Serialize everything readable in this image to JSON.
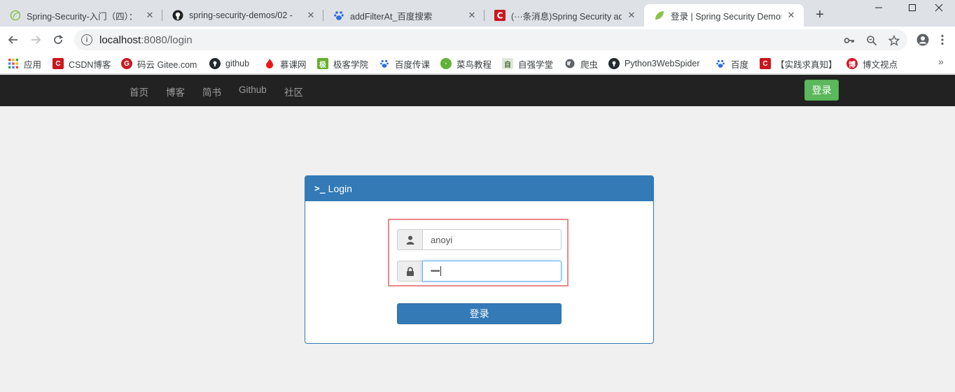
{
  "tabs": [
    {
      "title": "Spring-Security-入门（四）：",
      "active": false
    },
    {
      "title": "spring-security-demos/02 - ",
      "active": false
    },
    {
      "title": "addFilterAt_百度搜索",
      "active": false
    },
    {
      "title": "(···条消息)Spring Security add",
      "active": false
    },
    {
      "title": "登录 | Spring Security Demos",
      "active": true
    }
  ],
  "address": {
    "host": "localhost",
    "rest": ":8080/login"
  },
  "bookmarks": [
    {
      "label": "应用",
      "icon": "apps-grid-icon",
      "color": "#e8453c"
    },
    {
      "label": "CSDN博客",
      "icon": "csdn-icon",
      "color": "#c9171e"
    },
    {
      "label": "码云 Gitee.com",
      "icon": "gitee-icon",
      "color": "#c71d23"
    },
    {
      "label": "github",
      "icon": "github-icon",
      "color": "#24292e"
    },
    {
      "label": "慕课网",
      "icon": "imooc-icon",
      "color": "#f01414"
    },
    {
      "label": "极客学院",
      "icon": "jikexueyuan-icon",
      "color": "#65b02c"
    },
    {
      "label": "百度传课",
      "icon": "baidu-paw-icon",
      "color": "#2f6fe0"
    },
    {
      "label": "菜鸟教程",
      "icon": "runoob-icon",
      "color": "#5fb336"
    },
    {
      "label": "自强学堂",
      "icon": "ziqiang-icon",
      "color": "#7a9a6a"
    },
    {
      "label": "爬虫",
      "icon": "globe-icon",
      "color": "#5f6368"
    },
    {
      "label": "Python3WebSpider",
      "icon": "github-icon",
      "color": "#24292e"
    },
    {
      "label": "百度",
      "icon": "baidu-paw-icon",
      "color": "#2f6fe0"
    },
    {
      "label": "【实践求真知】",
      "icon": "csdn-icon",
      "color": "#c9171e"
    },
    {
      "label": "博文视点",
      "icon": "bowen-icon",
      "color": "#d7192a"
    }
  ],
  "nav": {
    "links": [
      "首页",
      "博客",
      "简书",
      "Github",
      "社区"
    ],
    "login_button": "登录"
  },
  "panel": {
    "prompt": ">_",
    "title": "Login",
    "username": "anoyi",
    "password_mask": "•••••",
    "submit": "登录"
  },
  "colors": {
    "primary": "#337ab7",
    "success": "#5cb85c",
    "navbar": "#222222",
    "highlight": "#e9898a"
  }
}
